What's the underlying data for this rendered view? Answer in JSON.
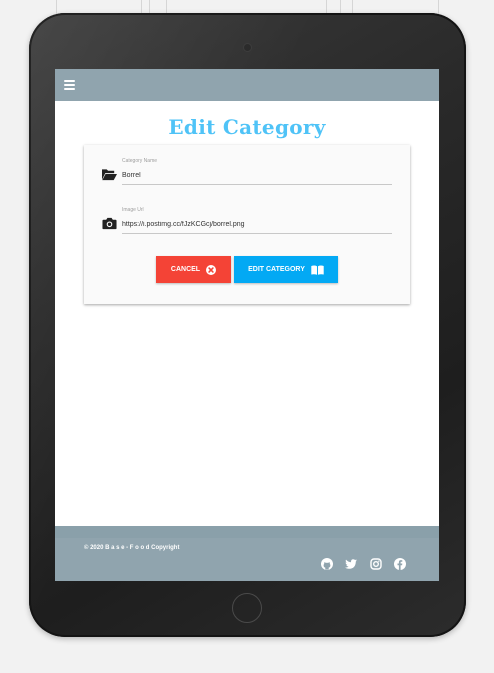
{
  "page": {
    "title": "Edit Category"
  },
  "form": {
    "category_name": {
      "label": "Category Name",
      "value": "Borrel"
    },
    "image_url": {
      "label": "Image Url",
      "value": "https://i.postimg.cc/fJzKCGcj/borrel.png"
    },
    "cancel_label": "CANCEL",
    "submit_label": "EDIT CATEGORY"
  },
  "footer": {
    "copyright": "© 2020 B a s e - F o o d Copyright",
    "social_icons": [
      "github-icon",
      "twitter-icon",
      "instagram-icon",
      "facebook-icon"
    ]
  },
  "colors": {
    "header": "#90a4ae",
    "title": "#4fc3f7",
    "cancel": "#f44336",
    "submit": "#03a9f4"
  }
}
